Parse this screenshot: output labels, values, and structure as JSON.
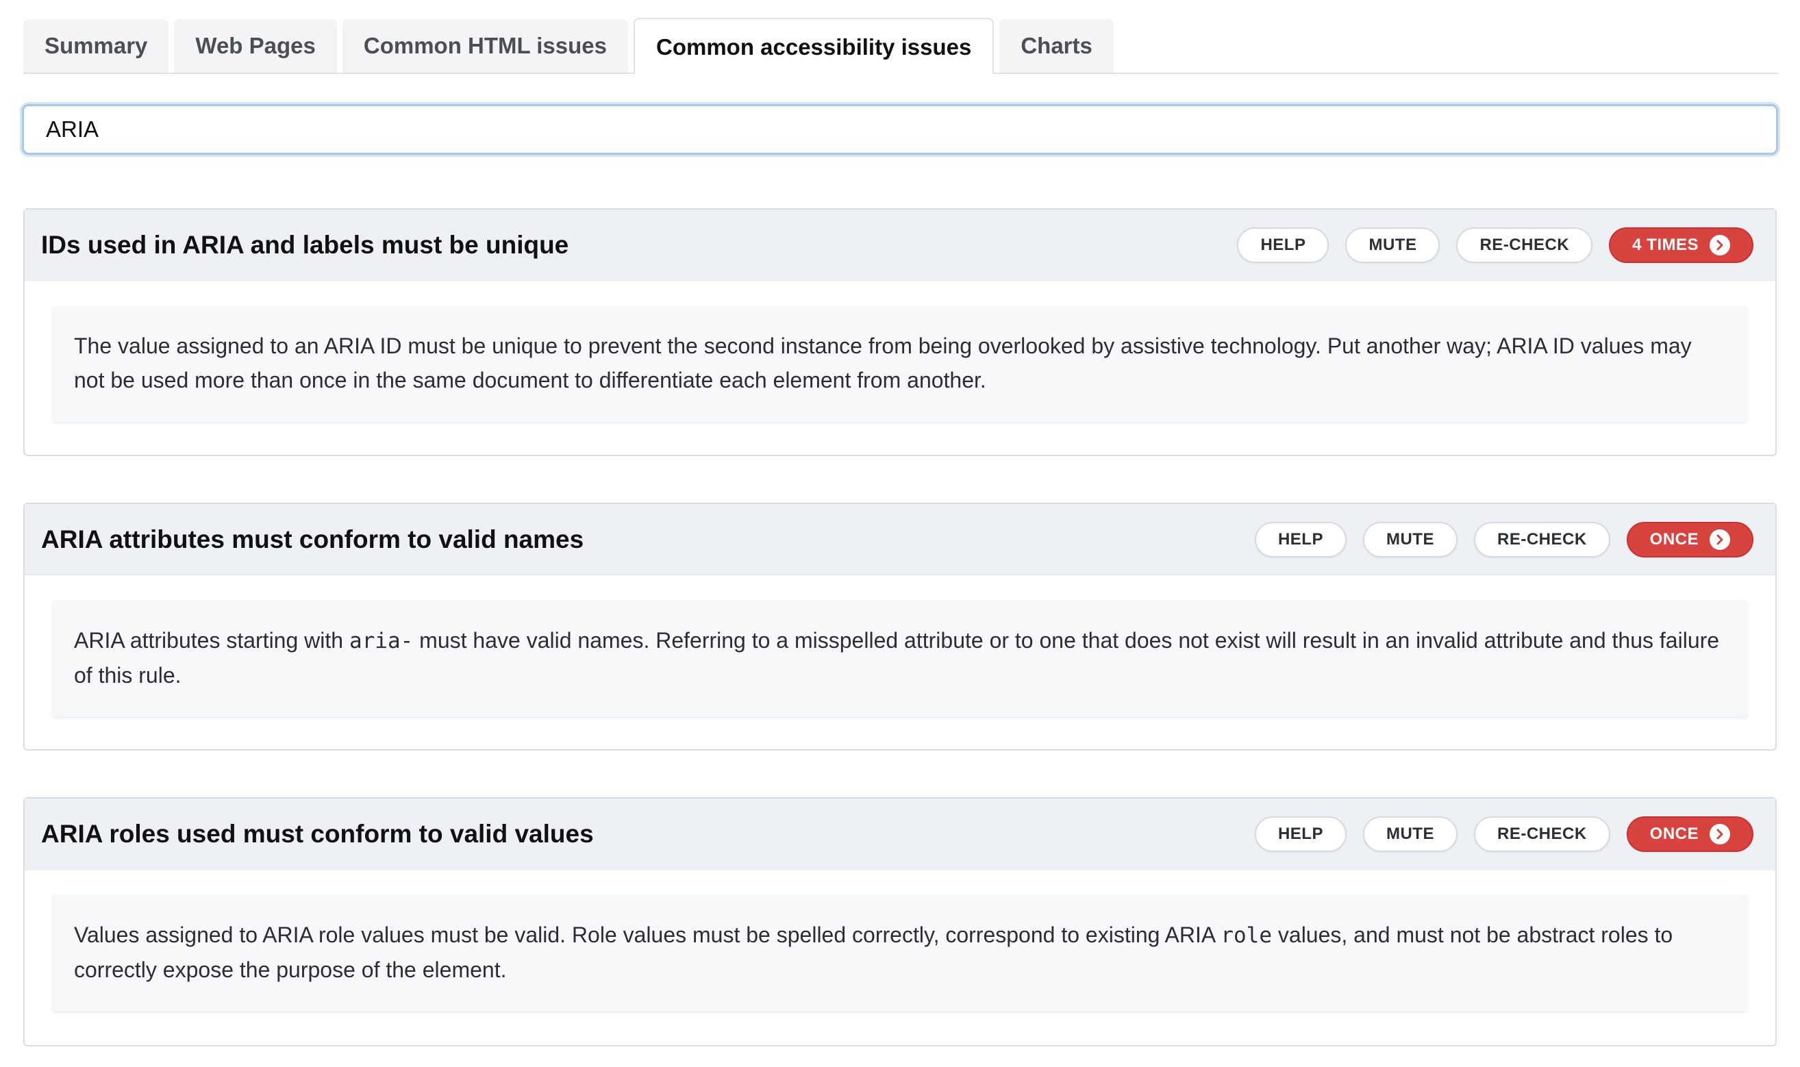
{
  "tabs": [
    {
      "label": "Summary"
    },
    {
      "label": "Web Pages"
    },
    {
      "label": "Common HTML issues"
    },
    {
      "label": "Common accessibility issues"
    },
    {
      "label": "Charts"
    }
  ],
  "search": {
    "value": "ARIA"
  },
  "actions": {
    "help": "HELP",
    "mute": "MUTE",
    "recheck": "RE-CHECK"
  },
  "colors": {
    "count_badge": "#d9433f",
    "header_bg": "#edf0f5",
    "focus_ring": "#a9c7e8"
  },
  "issues": [
    {
      "title": "IDs used in ARIA and labels must be unique",
      "count": "4 TIMES",
      "desc_text": "The value assigned to an ARIA ID must be unique to prevent the second instance from being overlooked by assistive technology. Put another way; ARIA ID values may not be used more than once in the same document to differentiate each element from another."
    },
    {
      "title": "ARIA attributes must conform to valid names",
      "count": "ONCE",
      "desc_pre": "ARIA attributes starting with ",
      "desc_code": "aria-",
      "desc_post": " must have valid names. Referring to a misspelled attribute or to one that does not exist will result in an invalid attribute and thus failure of this rule."
    },
    {
      "title": "ARIA roles used must conform to valid values",
      "count": "ONCE",
      "desc_pre": "Values assigned to ARIA role values must be valid. Role values must be spelled correctly, correspond to existing ARIA ",
      "desc_code": "role",
      "desc_post": " values, and must not be abstract roles to correctly expose the purpose of the element."
    }
  ]
}
